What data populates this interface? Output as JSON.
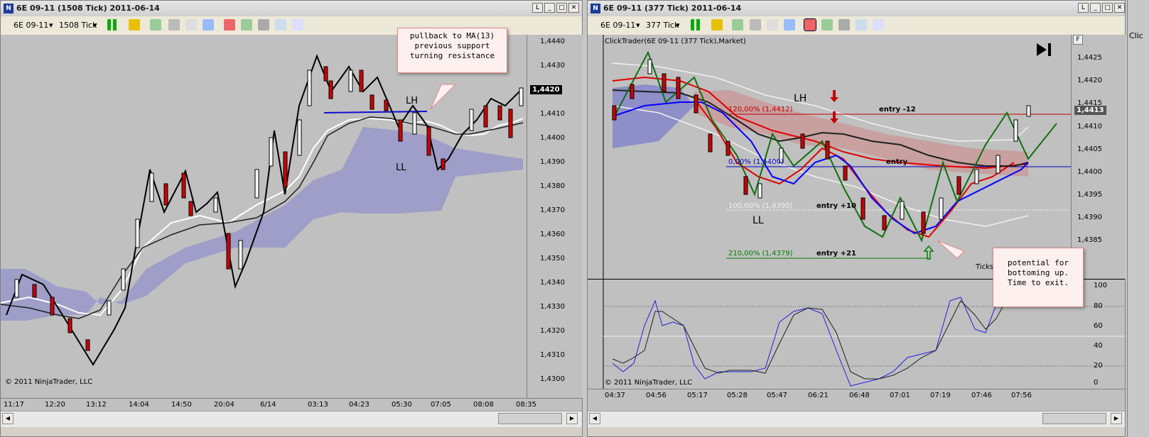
{
  "left_window": {
    "title": "6E 09-11 (1508 Tick)  2011-06-14",
    "toolbar": {
      "instrument": "6E 09-11",
      "interval": "1508 Tick"
    },
    "y_ticks": [
      "1,4440",
      "1,4430",
      "1,4420",
      "1,4410",
      "1,4400",
      "1,4390",
      "1,4380",
      "1,4370",
      "1,4360",
      "1,4350",
      "1,4340",
      "1,4330",
      "1,4320",
      "1,4310",
      "1,4300"
    ],
    "last_price": "1,4420",
    "x_ticks": [
      "11:17",
      "12:20",
      "13:12",
      "14:04",
      "14:50",
      "20:04",
      "6/14",
      "03:13",
      "04:23",
      "05:30",
      "07:05",
      "08:08",
      "08:35"
    ],
    "copyright": "© 2011 NinjaTrader, LLC",
    "callout": [
      "pullback to MA(13)",
      "previous support",
      "turning resistance"
    ],
    "label_lh": "LH",
    "label_ll": "LL"
  },
  "right_window": {
    "title": "6E 09-11 (377 Tick)  2011-06-14",
    "toolbar": {
      "instrument": "6E 09-11",
      "interval": "377 Tick"
    },
    "chart_header": "ClickTrader(6E 09-11 (377 Tick),Market)",
    "y_ticks": [
      "1,4425",
      "1,4420",
      "1,4415",
      "1,4410",
      "1,4405",
      "1,4400",
      "1,4395",
      "1,4390",
      "1,4385"
    ],
    "last_price": "1,4413",
    "fib_120": "120,00% (1,4412)",
    "fib_0": "0,00% (1,4400)",
    "fib_100": "100,00% (1,4390)",
    "fib_210": "210,00% (1,4379)",
    "entry_minus12": "entry -12",
    "entry": "entry",
    "entry_plus10": "entry +10",
    "entry_plus21": "entry +21",
    "label_lh": "LH",
    "label_ll": "LL",
    "ticks_label": "Ticks",
    "osc_ticks": [
      "100",
      "80",
      "60",
      "40",
      "20",
      "0"
    ],
    "x_ticks": [
      "04:37",
      "04:56",
      "05:17",
      "05:28",
      "05:47",
      "06:21",
      "06:48",
      "07:01",
      "07:19",
      "07:46",
      "07:56"
    ],
    "copyright": "© 2011 NinjaTrader, LLC",
    "callout": [
      "potential for",
      "bottoming up.",
      "Time to exit."
    ],
    "f_button": "F"
  },
  "far_right": {
    "text": "Clic"
  }
}
